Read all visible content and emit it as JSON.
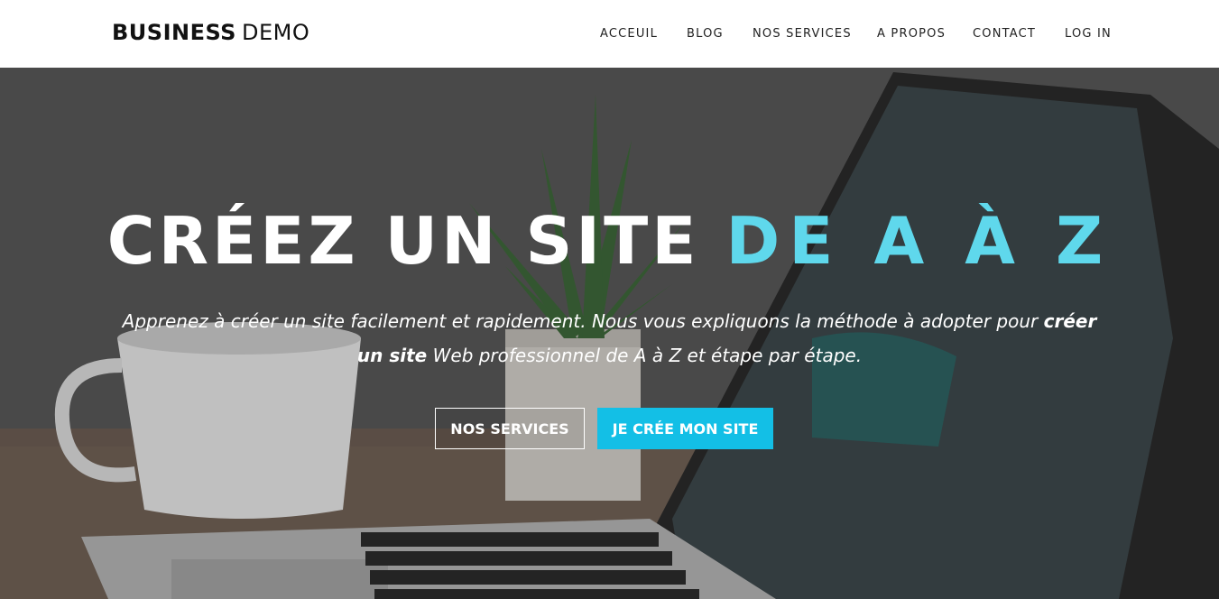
{
  "header": {
    "logo_bold": "BUSINESS",
    "logo_light": "DEMO",
    "nav": [
      {
        "label": "ACCEUIL"
      },
      {
        "label": "BLOG"
      },
      {
        "label": "NOS SERVICES"
      },
      {
        "label": "A PROPOS"
      },
      {
        "label": "CONTACT"
      },
      {
        "label": "LOG IN"
      }
    ]
  },
  "hero": {
    "title_main": "CRÉEZ UN SITE ",
    "title_accent": "DE A À Z",
    "subtitle_part1": "Apprenez à créer un site facilement et rapidement. Nous vous expliquons la méthode à adopter pour ",
    "subtitle_bold": "créer un site",
    "subtitle_part2": " Web professionnel de A à Z et étape par étape.",
    "btn_services": "NOS SERVICES",
    "btn_create": "JE CRÉE MON SITE"
  },
  "colors": {
    "accent": "#5fd8ec",
    "button_primary": "#13bfe6",
    "header_bg": "#ffffff"
  }
}
